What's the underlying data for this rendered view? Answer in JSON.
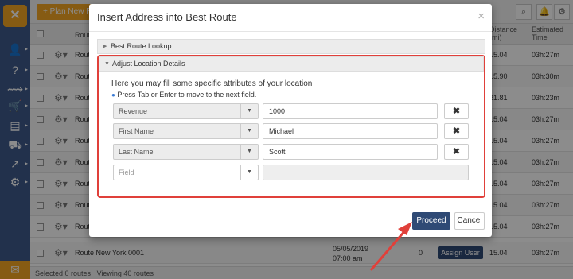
{
  "topbar": {
    "plan_button": "+ Plan New Ro"
  },
  "table": {
    "header": {
      "name": "Route",
      "distance": "Distance (mi)",
      "time": "Estimated Time"
    },
    "rows": [
      {
        "name": "Route",
        "distance": "15.04",
        "time": "03h:27m"
      },
      {
        "name": "Route",
        "distance": "15.90",
        "time": "03h:30m"
      },
      {
        "name": "Route",
        "distance": "21.81",
        "time": "03h:23m"
      },
      {
        "name": "Route",
        "distance": "15.04",
        "time": "03h:27m"
      },
      {
        "name": "Route",
        "distance": "15.04",
        "time": "03h:27m"
      },
      {
        "name": "Route",
        "distance": "15.04",
        "time": "03h:27m"
      },
      {
        "name": "Route",
        "distance": "15.04",
        "time": "03h:27m"
      },
      {
        "name": "Route",
        "distance": "15.04",
        "time": "03h:27m"
      },
      {
        "name": "Route",
        "distance": "15.04",
        "time": "03h:27m"
      },
      {
        "name": "Route",
        "distance": "15.04",
        "time": "03h:27m"
      }
    ],
    "last_row": {
      "name": "Route New York 0001",
      "date": "05/05/2019",
      "time_of_day": "07:00 am",
      "count": "0",
      "assign": "Assign User",
      "distance": "15.04",
      "time": "03h:27m"
    }
  },
  "footer": {
    "selected": "Selected 0 routes",
    "viewing": "Viewing 40 routes"
  },
  "modal": {
    "title": "Insert Address into Best Route",
    "close": "×",
    "panel1": "Best Route Lookup",
    "panel2": "Adjust Location Details",
    "intro": "Here you may fill some specific attributes of your location",
    "hint": "Press Tab or Enter to move to the next field.",
    "fields": [
      {
        "name": "Revenue",
        "value": "1000"
      },
      {
        "name": "First Name",
        "value": "Michael"
      },
      {
        "name": "Last Name",
        "value": "Scott"
      }
    ],
    "empty_field_placeholder": "Field",
    "remove_label": "✖",
    "proceed": "Proceed",
    "cancel": "Cancel"
  },
  "colors": {
    "highlight": "#e0403a",
    "primary": "#2f4a75",
    "accent": "#f5a623"
  }
}
